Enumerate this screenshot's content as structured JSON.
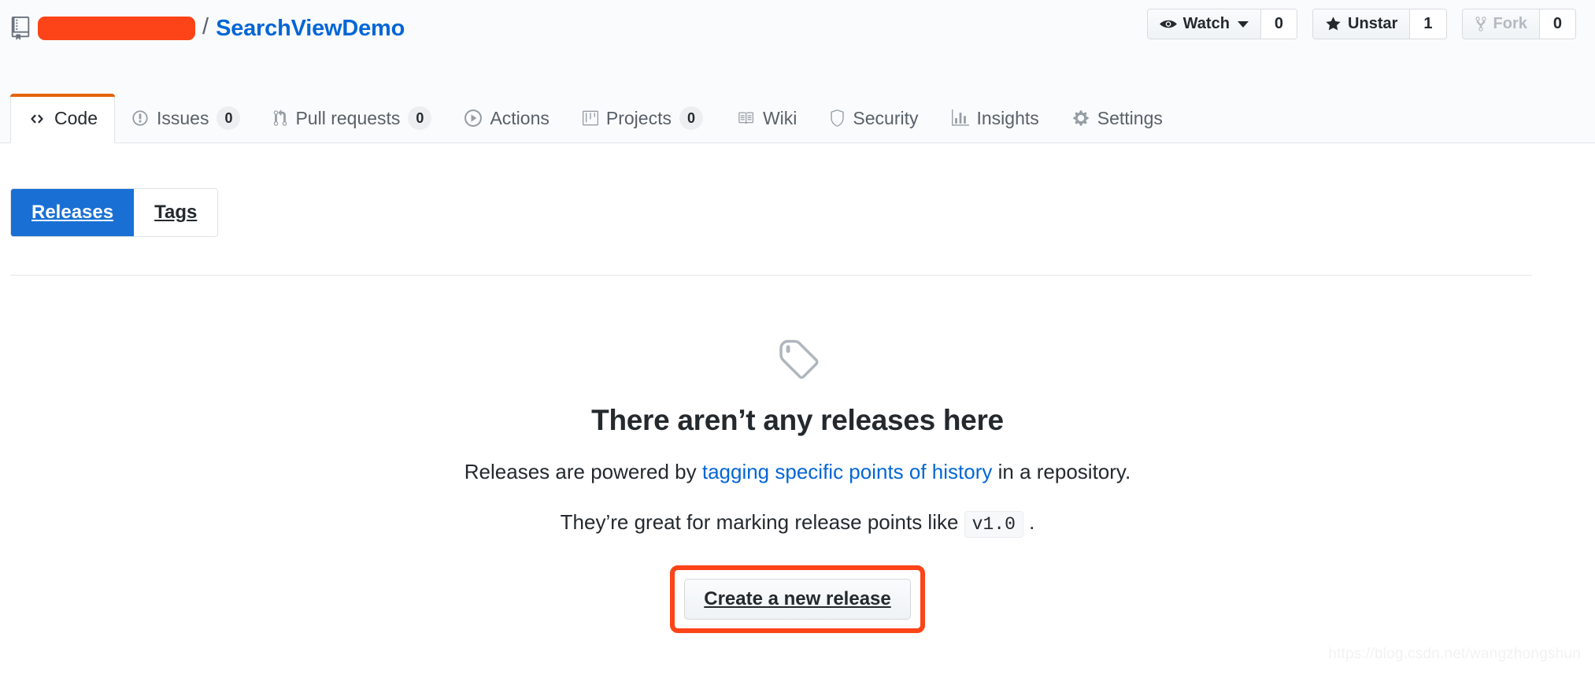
{
  "repo": {
    "owner_redacted": true,
    "separator": "/",
    "name": "SearchViewDemo",
    "icon": "repo-icon"
  },
  "actions": [
    {
      "id": "watch",
      "label": "Watch",
      "count": "0",
      "icon": "eye-icon",
      "has_caret": true,
      "disabled": false
    },
    {
      "id": "unstar",
      "label": "Unstar",
      "count": "1",
      "icon": "star-icon",
      "has_caret": false,
      "disabled": false
    },
    {
      "id": "fork",
      "label": "Fork",
      "count": "0",
      "icon": "fork-icon",
      "has_caret": false,
      "disabled": true
    }
  ],
  "nav": [
    {
      "id": "code",
      "label": "Code",
      "icon": "code-icon",
      "count": null,
      "selected": true
    },
    {
      "id": "issues",
      "label": "Issues",
      "icon": "issue-icon",
      "count": "0",
      "selected": false
    },
    {
      "id": "pull-requests",
      "label": "Pull requests",
      "icon": "pr-icon",
      "count": "0",
      "selected": false
    },
    {
      "id": "actions",
      "label": "Actions",
      "icon": "play-icon",
      "count": null,
      "selected": false
    },
    {
      "id": "projects",
      "label": "Projects",
      "icon": "project-icon",
      "count": "0",
      "selected": false
    },
    {
      "id": "wiki",
      "label": "Wiki",
      "icon": "book-icon",
      "count": null,
      "selected": false
    },
    {
      "id": "security",
      "label": "Security",
      "icon": "shield-icon",
      "count": null,
      "selected": false
    },
    {
      "id": "insights",
      "label": "Insights",
      "icon": "graph-icon",
      "count": null,
      "selected": false
    },
    {
      "id": "settings",
      "label": "Settings",
      "icon": "gear-icon",
      "count": null,
      "selected": false
    }
  ],
  "subnav": {
    "releases_label": "Releases",
    "tags_label": "Tags",
    "active": "Releases"
  },
  "blankslate": {
    "icon": "tag-icon",
    "title": "There aren’t any releases here",
    "line1_before": "Releases are powered by ",
    "line1_link": "tagging specific points of history",
    "line1_after": " in a repository.",
    "line2_before": "They’re great for marking release points like ",
    "line2_code": "v1.0",
    "line2_after": " .",
    "cta_label": "Create a new release"
  },
  "watermark": "https://blog.csdn.net/wangzhongshun",
  "colors": {
    "accent_blue": "#0366d6",
    "selected_tab_underline": "#e36209",
    "annotation": "#fc4418",
    "subnav_active": "#1a6fd4",
    "header_bg": "#fafbfc"
  }
}
